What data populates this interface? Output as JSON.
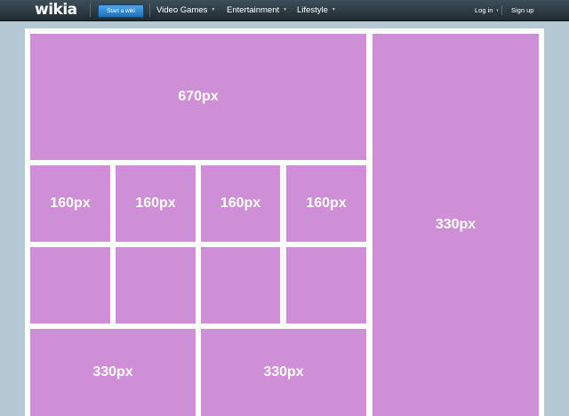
{
  "topbar": {
    "logo": "wikia",
    "start_button": "Start a wiki",
    "nav": [
      {
        "label": "Video Games"
      },
      {
        "label": "Entertainment"
      },
      {
        "label": "Lifestyle"
      }
    ],
    "login": "Log in",
    "signup": "Sign up",
    "caret_glyph": "▼"
  },
  "grid": {
    "main": "670px",
    "right_rail": "330px",
    "small": [
      "160px",
      "160px",
      "160px",
      "160px"
    ],
    "bottom": [
      "330px",
      "330px"
    ]
  },
  "colors": {
    "block": "#cf8fd6",
    "background": "#b4c9d4"
  }
}
